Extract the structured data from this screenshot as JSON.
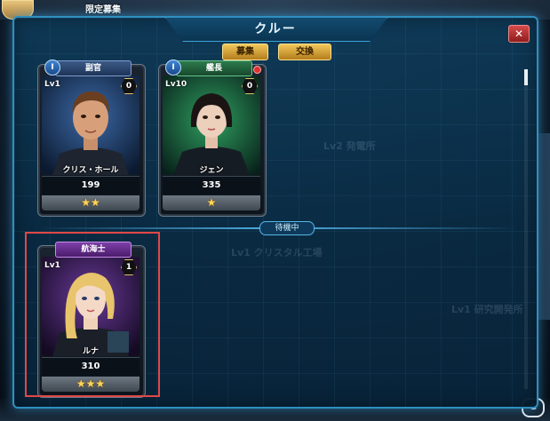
{
  "background": {
    "top_label": "限定募集",
    "bg_texts": [
      "Lv2 発電所",
      "Lv1 クリスタル工場",
      "Lv1 研究開発所"
    ],
    "watermark": "G"
  },
  "panel": {
    "title": "クルー",
    "close_label": "✕",
    "tabs": [
      {
        "label": "募集",
        "active": true
      },
      {
        "label": "交換",
        "active": false
      }
    ],
    "divider_label": "待機中"
  },
  "crew_active": [
    {
      "role": "副官",
      "type_badge": "I",
      "level": "Lv1",
      "count": "0",
      "name": "クリス・ホール",
      "power": "199",
      "stars": "★★",
      "star_count": 2,
      "portrait": "male-brown-hair",
      "banner_color": "#3c5a86"
    },
    {
      "role": "艦長",
      "type_badge": "I",
      "level": "Lv10",
      "count": "0",
      "name": "ジェン",
      "power": "335",
      "stars": "★",
      "star_count": 1,
      "portrait": "female-short-dark-hair",
      "banner_color": "#2d7a4c",
      "notification": true
    }
  ],
  "crew_standby": [
    {
      "role": "航海士",
      "level": "Lv1",
      "count": "1",
      "name": "ルナ",
      "power": "310",
      "stars": "★★★",
      "star_count": 3,
      "portrait": "female-blonde",
      "banner_color": "#7d3fa8",
      "selected": true
    }
  ]
}
